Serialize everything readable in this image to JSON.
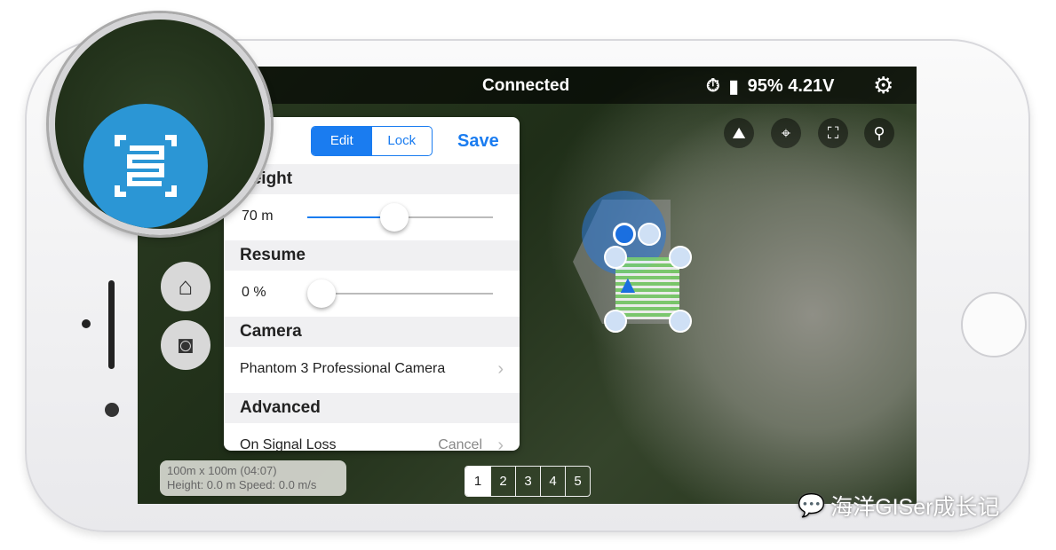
{
  "topbar": {
    "title": "Connected",
    "battery": "95% 4.21V",
    "icons": [
      "timer-off-icon",
      "battery-icon",
      "gear-icon"
    ]
  },
  "map_buttons": [
    "terrain-icon",
    "locate-icon",
    "fullscreen-icon",
    "pin-icon"
  ],
  "side_buttons": [
    "home-icon",
    "camera-icon"
  ],
  "panel": {
    "mode_options": [
      "Edit",
      "Lock"
    ],
    "mode_selected": "Edit",
    "save": "Save",
    "height_label": "Height",
    "height_value": "70 m",
    "height_fraction": 0.47,
    "resume_label": "Resume",
    "resume_value": "0 %",
    "resume_fraction": 0,
    "camera_label": "Camera",
    "camera_value": "Phantom 3 Professional Camera",
    "advanced_label": "Advanced",
    "signal_label": "On Signal Loss",
    "signal_value": "Cancel"
  },
  "info": {
    "line1": "100m x 100m (04:07)",
    "line2": "Height: 0.0 m Speed: 0.0 m/s"
  },
  "pages": [
    "1",
    "2",
    "3",
    "4",
    "5"
  ],
  "page_selected": "1",
  "watermark": "海洋GISer成长记",
  "colors": {
    "accent": "#1a7cf0",
    "mission_icon": "#2b96d5"
  }
}
